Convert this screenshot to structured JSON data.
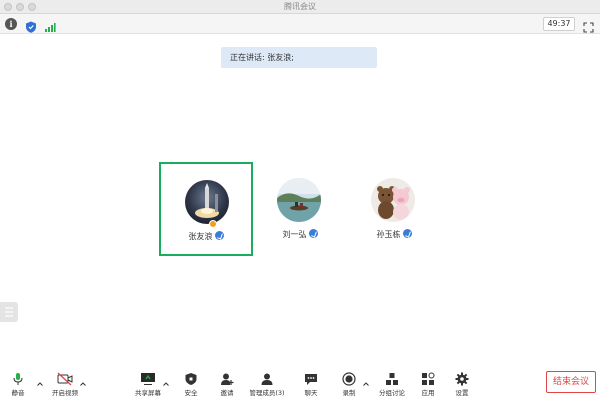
{
  "window": {
    "title": "腾讯会议"
  },
  "infobar": {
    "timer": "49:37",
    "icons": [
      "info-icon",
      "shield-icon",
      "signal-icon",
      "fullscreen-icon"
    ]
  },
  "banner": {
    "speaking": "正在讲话: 张友浪;"
  },
  "participants": [
    {
      "name": "张友浪",
      "speaking": true
    },
    {
      "name": "刘一弘",
      "speaking": false
    },
    {
      "name": "孙玉栋",
      "speaking": false
    }
  ],
  "toolbar": {
    "mute": "静音",
    "video": "开启视频",
    "share": "共享屏幕",
    "security": "安全",
    "invite": "邀请",
    "members": "管理成员(3)",
    "chat": "聊天",
    "record": "录制",
    "breakout": "分组讨论",
    "apps": "应用",
    "settings": "设置",
    "end": "结束会议"
  },
  "colors": {
    "active_border": "#1aad5e",
    "end_button": "#e04545",
    "banner_bg": "#dde9f7",
    "badge": "#3b7cd8"
  }
}
